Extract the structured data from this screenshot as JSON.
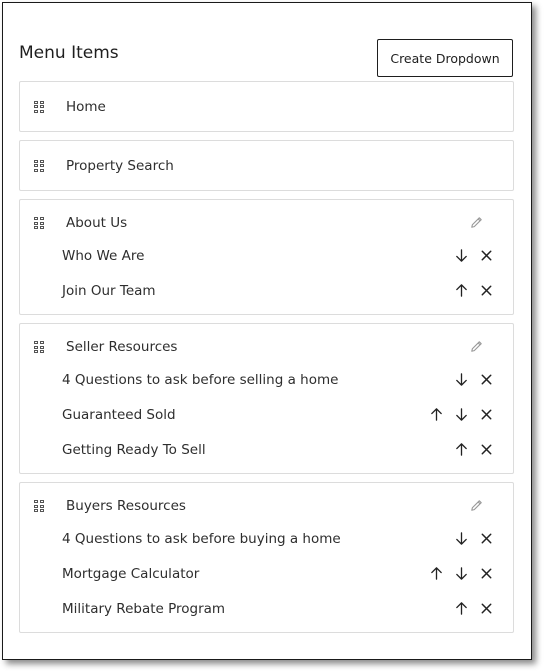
{
  "header": {
    "title": "Menu Items",
    "create_button_label": "Create Dropdown"
  },
  "menu": [
    {
      "label": "Home",
      "children": []
    },
    {
      "label": "Property Search",
      "children": []
    },
    {
      "label": "About Us",
      "children": [
        {
          "label": "Who We Are",
          "up": false,
          "down": true
        },
        {
          "label": "Join Our Team",
          "up": true,
          "down": false
        }
      ]
    },
    {
      "label": "Seller Resources",
      "children": [
        {
          "label": "4 Questions to ask before selling a home",
          "up": false,
          "down": true
        },
        {
          "label": "Guaranteed Sold",
          "up": true,
          "down": true
        },
        {
          "label": "Getting Ready To Sell",
          "up": true,
          "down": false
        }
      ]
    },
    {
      "label": "Buyers Resources",
      "children": [
        {
          "label": "4 Questions to ask before buying a home",
          "up": false,
          "down": true
        },
        {
          "label": "Mortgage Calculator",
          "up": true,
          "down": true
        },
        {
          "label": "Military Rebate Program",
          "up": true,
          "down": false
        }
      ]
    }
  ],
  "icons": {
    "handle": "drag-handle-icon",
    "edit": "pencil-icon",
    "up": "arrow-up-icon",
    "down": "arrow-down-icon",
    "remove": "close-icon"
  },
  "colors": {
    "border": "#dcdcdc",
    "text": "#2e2e2e",
    "pencil": "#9a9a9a"
  }
}
